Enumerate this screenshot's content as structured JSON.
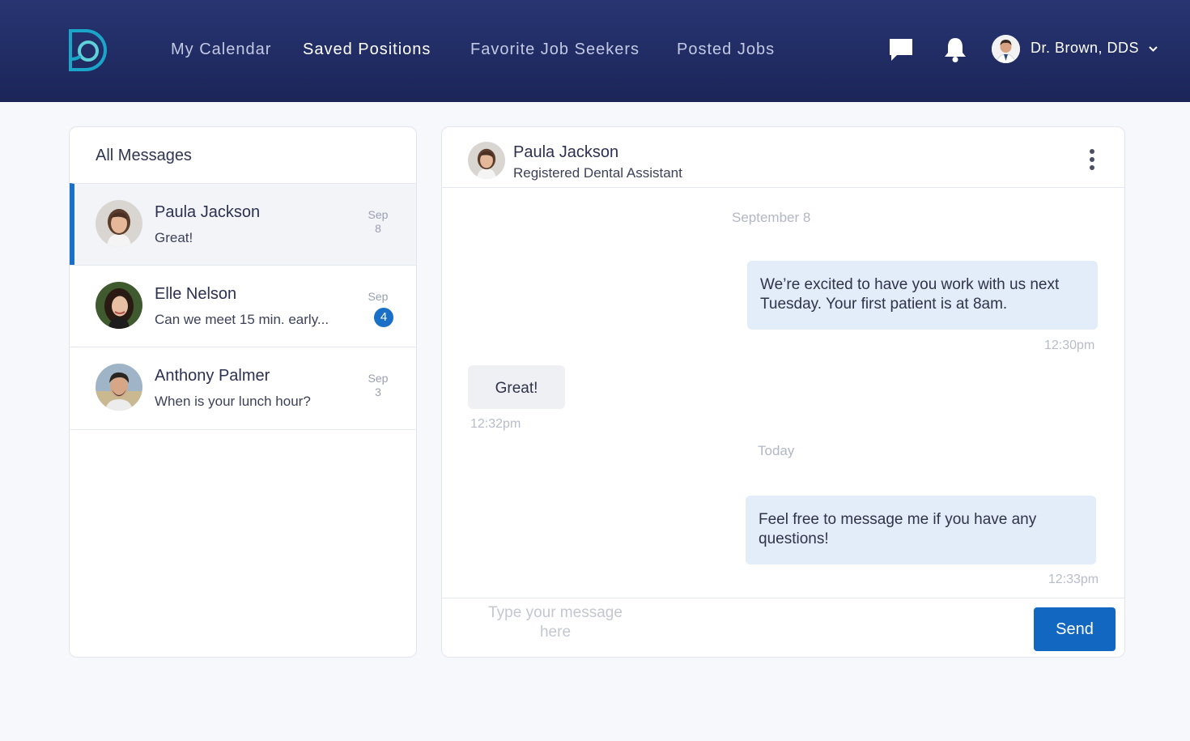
{
  "nav": {
    "links": [
      "My Calendar",
      "Saved Positions",
      "Favorite Job Seekers",
      "Posted Jobs"
    ],
    "active": "Saved Positions",
    "icons": [
      "messages-icon",
      "bell-icon"
    ]
  },
  "user": {
    "name": "Dr. Brown, DDS"
  },
  "inbox": {
    "title": "All Messages",
    "conversations": [
      {
        "name": "Paula Jackson",
        "preview": "Great!",
        "date_month": "Sep",
        "date_day": "8",
        "unread": ""
      },
      {
        "name": "Elle Nelson",
        "preview": "Can we meet 15 min. early...",
        "date_month": "Sep",
        "date_day": "",
        "unread": "4"
      },
      {
        "name": "Anthony Palmer",
        "preview": "When is your lunch hour?",
        "date_month": "Sep",
        "date_day": "3",
        "unread": ""
      }
    ]
  },
  "chat": {
    "contact_name": "Paula Jackson",
    "contact_role": "Registered Dental Assistant",
    "day1": "September 8",
    "msg1": {
      "text": "We’re excited to have you work with us next Tuesday. Your first patient is at 8am.",
      "time": "12:30pm"
    },
    "msg2": {
      "text": "Great!",
      "time": "12:32pm"
    },
    "day2": "Today",
    "msg3": {
      "text": "Feel free to message me if you have any questions!",
      "time": "12:33pm"
    },
    "composer_placeholder": "Type your message here",
    "send_label": "Send"
  },
  "colors": {
    "nav_bg": "#1f2a62",
    "accent": "#1267c1",
    "outgoing_bubble": "#e3edf9",
    "incoming_bubble": "#eef0f4"
  }
}
